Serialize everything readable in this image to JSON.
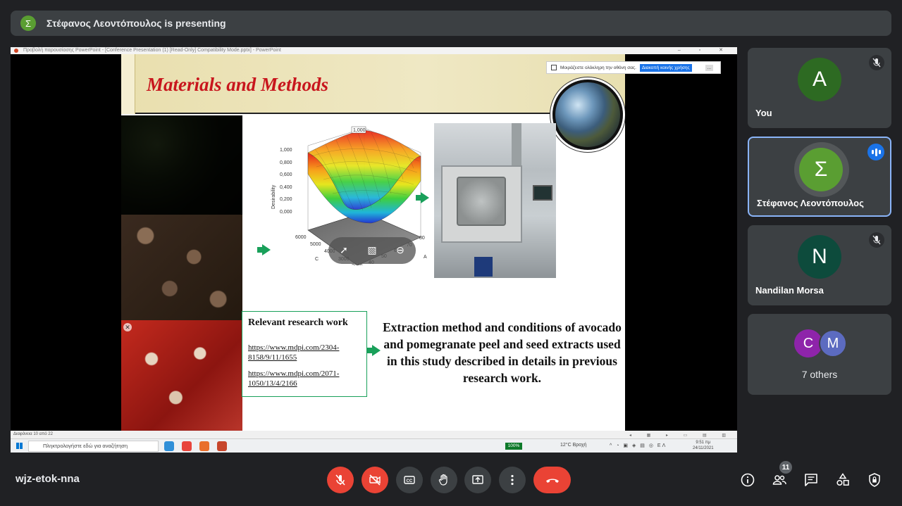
{
  "banner": {
    "avatar_letter": "Σ",
    "text": "Στέφανος Λεοντόπουλος is presenting"
  },
  "ppt": {
    "window_title": "Προβολή παρουσίασης PowerPoint - [Conference Presentation (1) [Read-Only] Compatibility Mode.pptx] - PowerPoint",
    "status_left": "Διαφάνεια 10 από 22",
    "share_bar": {
      "text": "Μοιράζεστε ολόκληρη την οθόνη σας.",
      "stop_button": "Διακοπή κοινής χρήσης",
      "more": "..."
    }
  },
  "slide": {
    "title": "Materials and Methods",
    "chart_labels": {
      "zlabel": "Desirability",
      "peak_value": "1,000",
      "z_ticks": [
        "1,000",
        "0,800",
        "0,600",
        "0,400",
        "0,200",
        "0,000"
      ],
      "c_ticks": [
        "6000",
        "5000",
        "4000",
        "3000",
        "2000"
      ],
      "c_label": "C",
      "a_ticks": [
        "80",
        "70",
        "60",
        "50",
        "40"
      ],
      "a_label": "A"
    },
    "ref_box": {
      "title": "Relevant research work",
      "link1": "https://www.mdpi.com/2304-8158/9/11/1655",
      "link2": "https://www.mdpi.com/2071-1050/13/4/2166"
    },
    "description": "Extraction method and conditions of avocado and pomegranate peel and seed extracts used in this study described in details in previous research work."
  },
  "taskbar": {
    "search_placeholder": "Πληκτρολογήστε εδώ για αναζήτηση",
    "zoom": "100%",
    "weather": "12°C Βροχή",
    "language": "ΕΛ",
    "time": "9:51 πμ",
    "date": "24/11/2021"
  },
  "participants": [
    {
      "letter": "A",
      "name": "You",
      "color": "#2d6a22"
    },
    {
      "letter": "Σ",
      "name": "Στέφανος Λεοντόπουλος",
      "color": "#5a9e32"
    },
    {
      "letter": "N",
      "name": "Nandilan Morsa",
      "color": "#0d4b3c"
    }
  ],
  "others": {
    "avatars": [
      "C",
      "M"
    ],
    "label": "7 others",
    "colors": [
      "#8e24aa",
      "#5c6bc0"
    ]
  },
  "bottom": {
    "meeting_code": "wjz-etok-nna",
    "participant_count": "11"
  },
  "colors": {
    "accent": "#8ab4f8",
    "danger": "#ea4335",
    "title_red": "#c8161d",
    "arrow_green": "#19a05a"
  }
}
